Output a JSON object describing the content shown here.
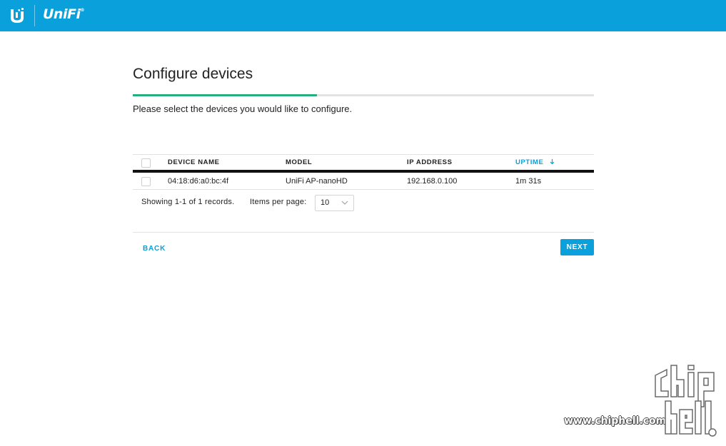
{
  "header": {
    "brand": "UniFi",
    "trademark": "®",
    "bg_color": "#0aa0dc",
    "icons": [
      "ubiquiti-u-logo-icon"
    ]
  },
  "page": {
    "title": "Configure devices",
    "subtitle": "Please select the devices you would like to configure.",
    "progress": 0.4,
    "progress_color": "#26ae7d"
  },
  "table": {
    "columns": [
      {
        "key": "device_name",
        "label": "DEVICE NAME"
      },
      {
        "key": "model",
        "label": "MODEL"
      },
      {
        "key": "ip_address",
        "label": "IP ADDRESS"
      },
      {
        "key": "uptime",
        "label": "UPTIME",
        "sorted": "desc"
      }
    ],
    "rows": [
      {
        "selected": false,
        "device_name": "04:18:d6:a0:bc:4f",
        "model": "UniFi AP-nanoHD",
        "ip_address": "192.168.0.100",
        "uptime": "1m 31s"
      }
    ],
    "sort_icon": "arrow-down-icon"
  },
  "pagination": {
    "records_text": "Showing 1-1 of 1 records.",
    "per_page_label": "Items per page:",
    "per_page_value": "10"
  },
  "actions": {
    "back_label": "BACK",
    "next_label": "NEXT",
    "accent": "#0aa0dc"
  },
  "watermark": {
    "url": "www.chiphell.com"
  }
}
